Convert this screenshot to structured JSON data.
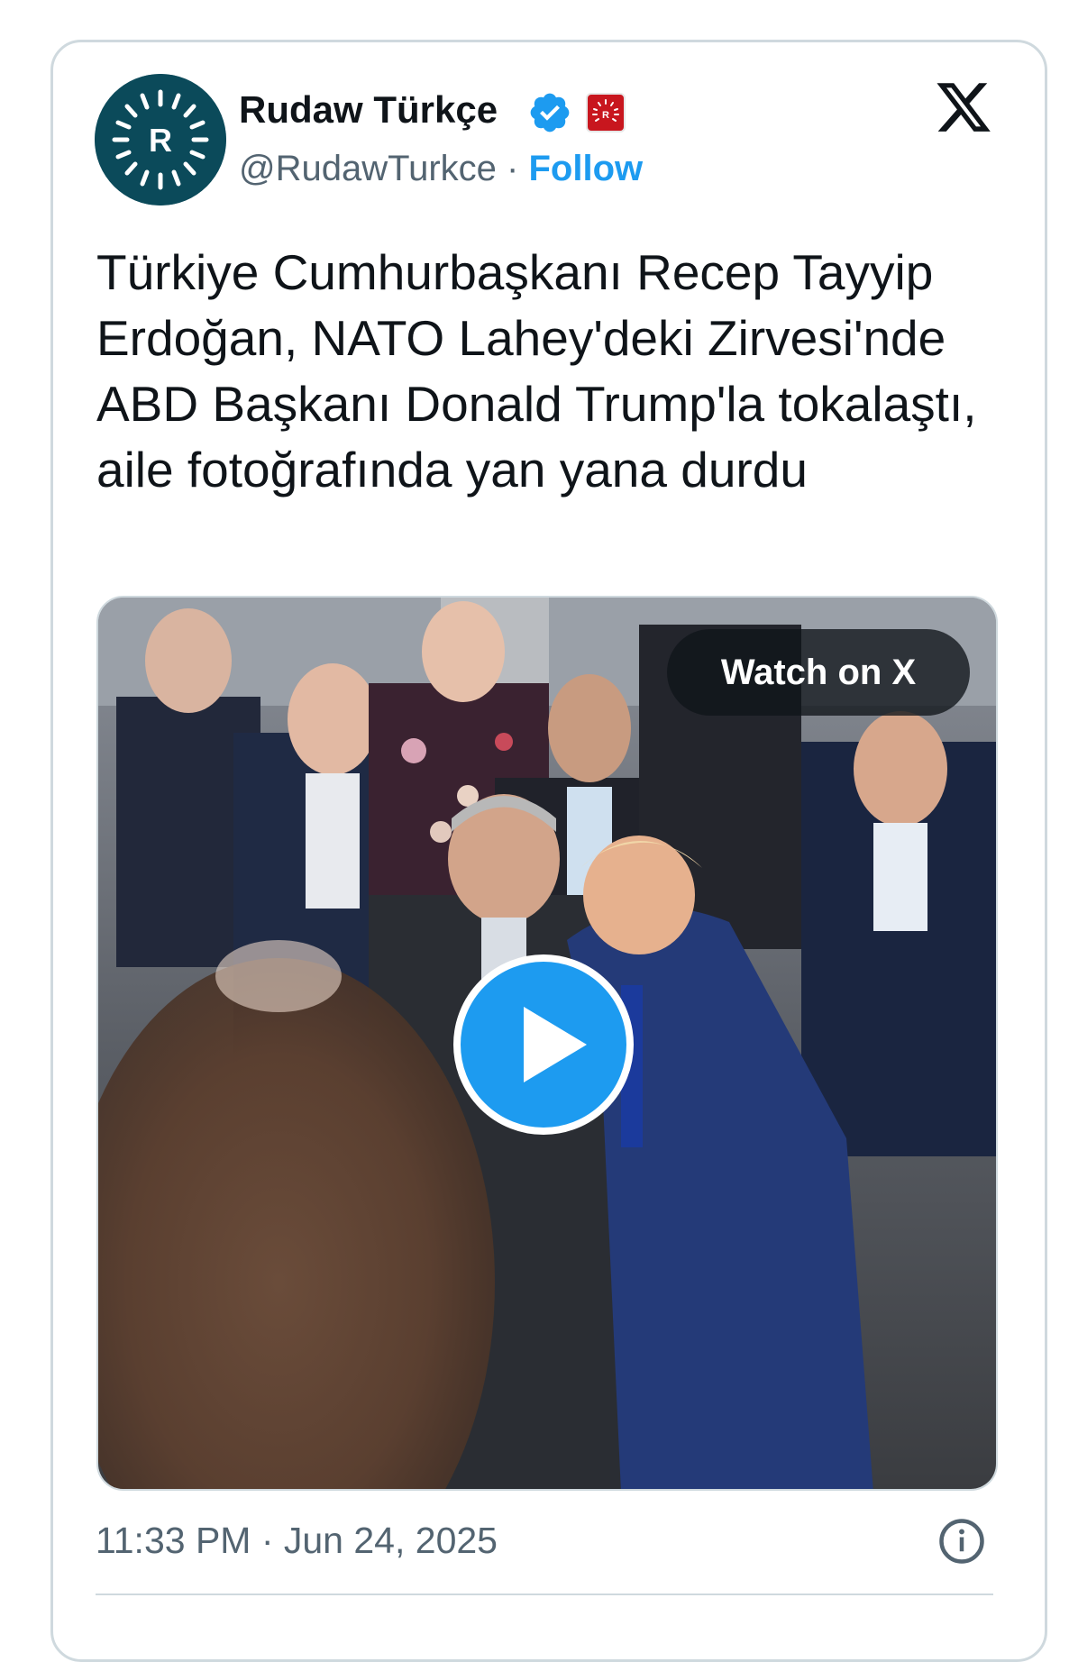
{
  "tweet": {
    "author": {
      "name": "Rudaw Türkçe",
      "handle": "@RudawTurkce",
      "separator": "·",
      "follow_label": "Follow",
      "verified_icon": "verified-badge-icon",
      "affiliate_icon": "rudaw-affiliate-badge"
    },
    "platform_logo": "x-logo-icon",
    "text": "Türkiye Cumhurbaşkanı Recep Tayyip Erdoğan, NATO Lahey'deki Zirvesi'nde ABD Başkanı Donald Trump'la tokalaştı, aile fotoğrafında yan yana durdu",
    "media": {
      "type": "video",
      "watch_label": "Watch on X",
      "play_icon": "play-icon"
    },
    "timestamp": "11:33 PM · Jun 24, 2025",
    "info_icon": "info-icon"
  },
  "colors": {
    "accent": "#1d9bf0",
    "secondary_text": "#536471",
    "border": "#cfd9de",
    "avatar_bg": "#0b4a5a",
    "affiliate_bg": "#c8161e"
  }
}
